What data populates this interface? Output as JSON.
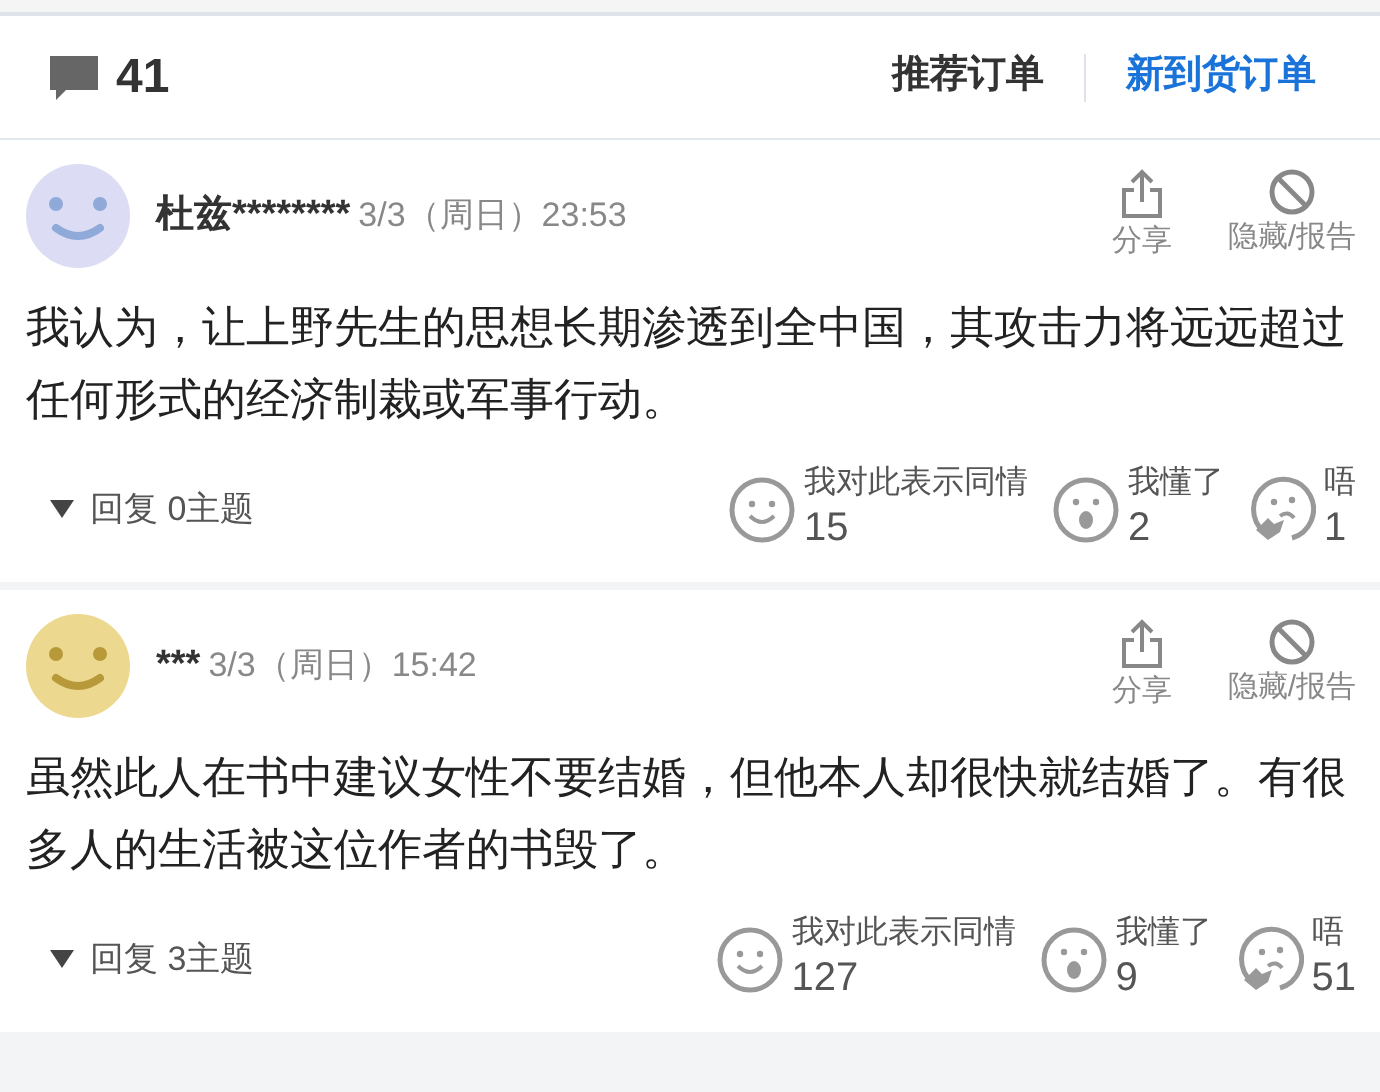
{
  "header": {
    "comment_count": "41",
    "tabs": [
      {
        "label": "推荐订单",
        "selected": false
      },
      {
        "label": "新到货订单",
        "selected": true
      }
    ]
  },
  "comments": [
    {
      "avatar": {
        "color": "#dcdcf4"
      },
      "author": "杜兹********",
      "time": "3/3（周日）23:53",
      "share": "分享",
      "hide": "隐藏/报告",
      "body": "我认为，让上野先生的思想长期渗透到全中国，其攻击力将远远超过任何形式的经济制裁或军事行动。",
      "replies": "回复 0主题",
      "reactions": [
        {
          "kind": "sympathy",
          "label": "我对此表示同情",
          "count": "15"
        },
        {
          "kind": "understand",
          "label": "我懂了",
          "count": "2"
        },
        {
          "kind": "hmm",
          "label": "唔",
          "count": "1"
        }
      ]
    },
    {
      "avatar": {
        "color": "#ecd88e"
      },
      "author": "***",
      "time": "3/3（周日）15:42",
      "share": "分享",
      "hide": "隐藏/报告",
      "body": "虽然此人在书中建议女性不要结婚，但他本人却很快就结婚了。有很多人的生活被这位作者的书毁了。",
      "replies": "回复 3主题",
      "reactions": [
        {
          "kind": "sympathy",
          "label": "我对此表示同情",
          "count": "127"
        },
        {
          "kind": "understand",
          "label": "我懂了",
          "count": "9"
        },
        {
          "kind": "hmm",
          "label": "唔",
          "count": "51"
        }
      ]
    }
  ]
}
